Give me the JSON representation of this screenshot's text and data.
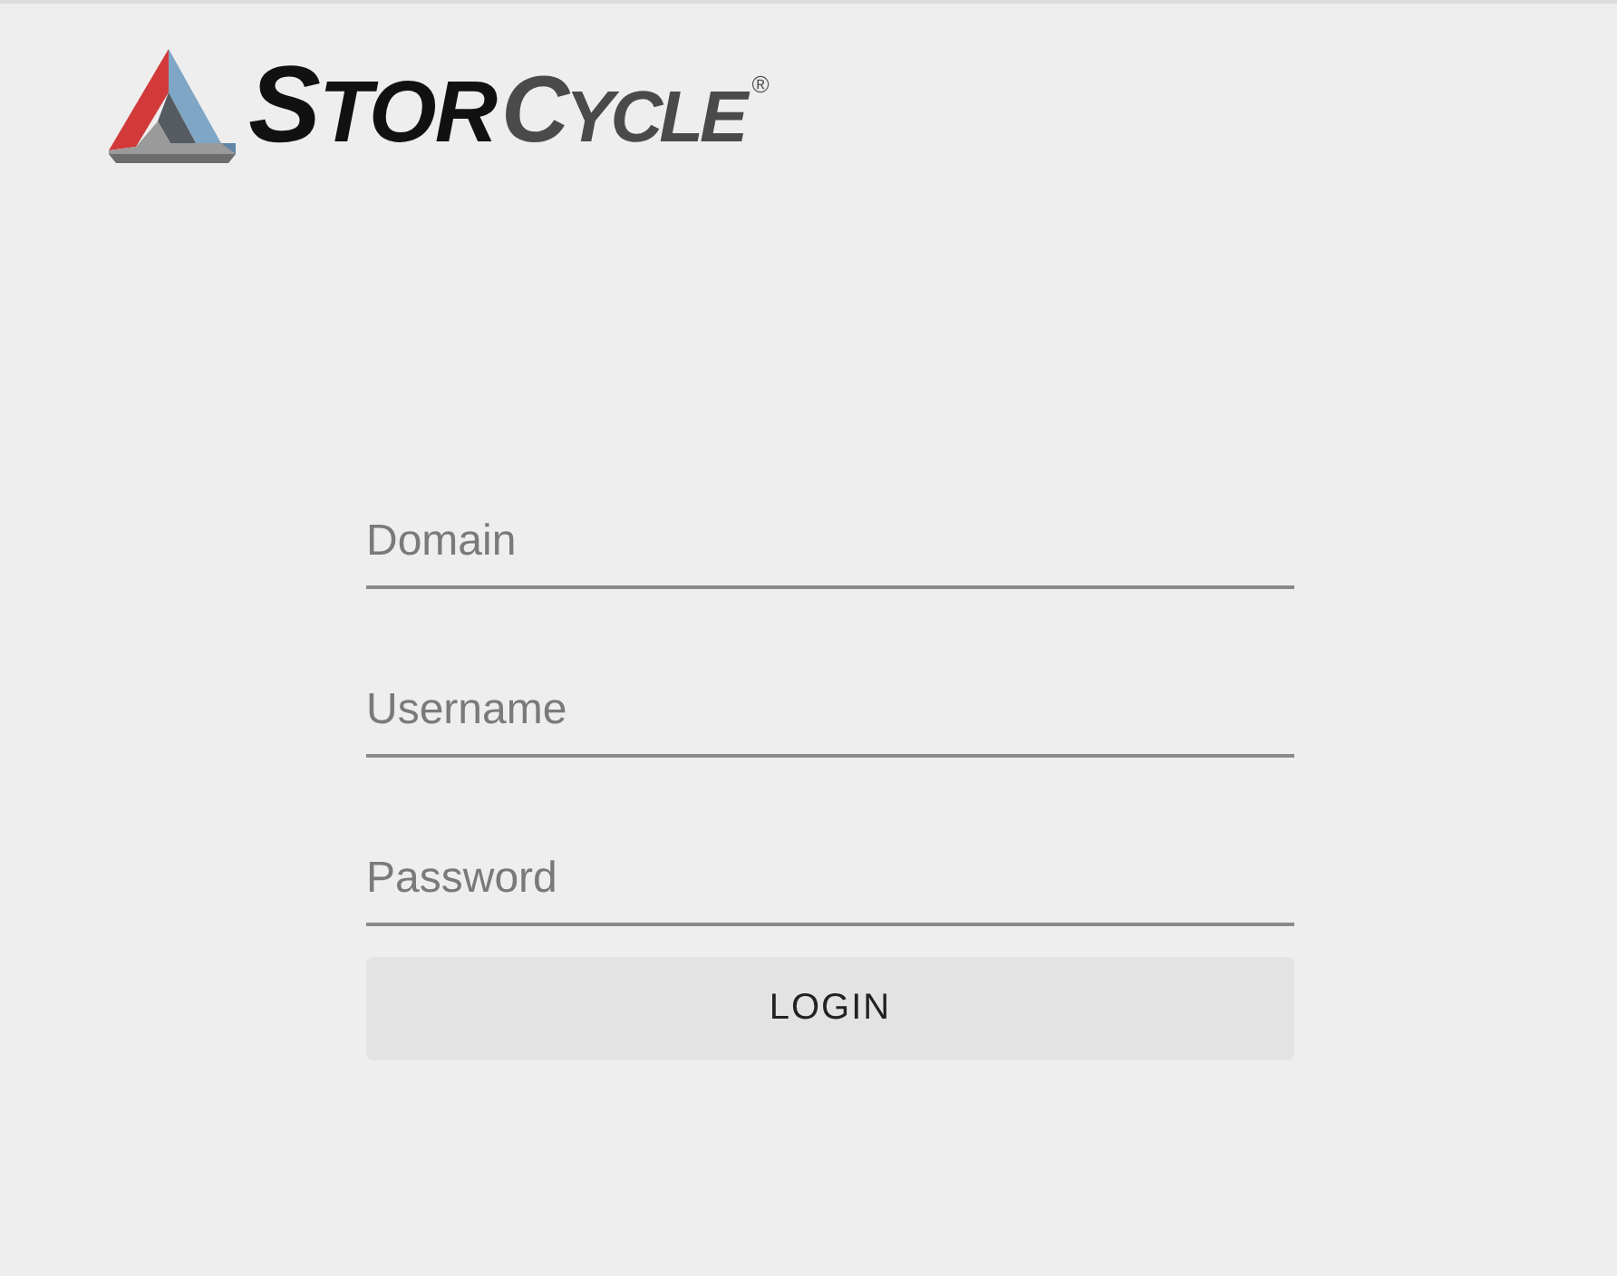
{
  "logo": {
    "wordmark": [
      "STOR",
      "CYCLE"
    ],
    "registered_mark": "®"
  },
  "form": {
    "fields": [
      {
        "placeholder": "Domain"
      },
      {
        "placeholder": "Username"
      },
      {
        "placeholder": "Password"
      }
    ],
    "submit_button": "LOGIN"
  }
}
